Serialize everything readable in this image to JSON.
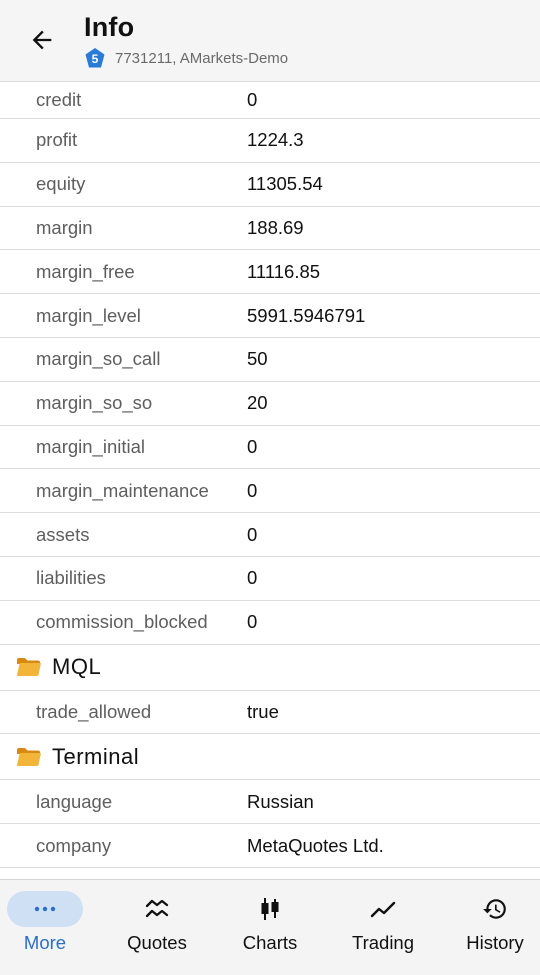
{
  "header": {
    "title": "Info",
    "badge_number": "5",
    "subtitle": "7731211, AMarkets-Demo"
  },
  "account_rows": [
    {
      "key": "credit",
      "value": "0"
    },
    {
      "key": "profit",
      "value": "1224.3"
    },
    {
      "key": "equity",
      "value": "11305.54"
    },
    {
      "key": "margin",
      "value": "188.69"
    },
    {
      "key": "margin_free",
      "value": "11116.85"
    },
    {
      "key": "margin_level",
      "value": "5991.5946791"
    },
    {
      "key": "margin_so_call",
      "value": "50"
    },
    {
      "key": "margin_so_so",
      "value": "20"
    },
    {
      "key": "margin_initial",
      "value": "0"
    },
    {
      "key": "margin_maintenance",
      "value": "0"
    },
    {
      "key": "assets",
      "value": "0"
    },
    {
      "key": "liabilities",
      "value": "0"
    },
    {
      "key": "commission_blocked",
      "value": "0"
    }
  ],
  "mql_section": {
    "title": "MQL",
    "rows": [
      {
        "key": "trade_allowed",
        "value": "true"
      }
    ]
  },
  "terminal_section": {
    "title": "Terminal",
    "rows": [
      {
        "key": "language",
        "value": "Russian"
      },
      {
        "key": "company",
        "value": "MetaQuotes Ltd."
      }
    ]
  },
  "bottom_nav": {
    "items": [
      {
        "label": "More",
        "icon": "more-dots-icon",
        "active": true
      },
      {
        "label": "Quotes",
        "icon": "quotes-icon",
        "active": false
      },
      {
        "label": "Charts",
        "icon": "candlestick-icon",
        "active": false
      },
      {
        "label": "Trading",
        "icon": "trend-line-icon",
        "active": false
      },
      {
        "label": "History",
        "icon": "history-clock-icon",
        "active": false
      }
    ]
  },
  "colors": {
    "accent": "#2a6fc4",
    "active_pill": "#cfe0f5",
    "badge": "#2a7bd8",
    "folder": "#f0a92e"
  }
}
